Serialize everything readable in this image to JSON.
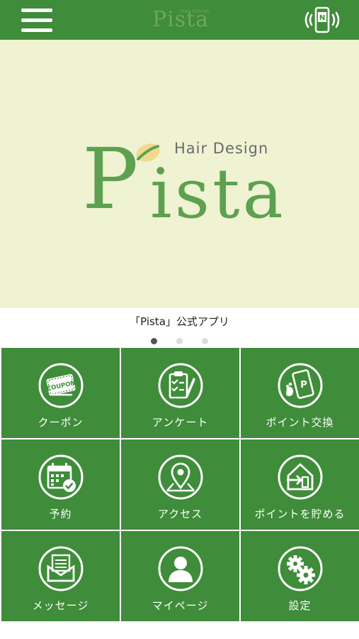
{
  "header": {
    "logo_text": "Pista",
    "logo_small": "Hair Design",
    "menu_icon": "hamburger-icon",
    "nfc_icon": "nfc-phone-icon",
    "color": "#3f8c3a"
  },
  "hero": {
    "logo_text": "Pista",
    "logo_subtitle": "Hair Design",
    "background": "#eff3d2",
    "logo_color": "#5da150"
  },
  "caption": "「Pista」公式アプリ",
  "carousel": {
    "count": 3,
    "active_index": 0
  },
  "menu": [
    {
      "label": "クーポン",
      "icon": "coupon-icon"
    },
    {
      "label": "アンケート",
      "icon": "survey-clipboard-icon"
    },
    {
      "label": "ポイント交換",
      "icon": "point-exchange-phone-icon"
    },
    {
      "label": "予約",
      "icon": "calendar-check-icon"
    },
    {
      "label": "アクセス",
      "icon": "map-pin-icon"
    },
    {
      "label": "ポイントを貯める",
      "icon": "collect-points-house-icon"
    },
    {
      "label": "メッセージ",
      "icon": "message-envelope-icon"
    },
    {
      "label": "マイページ",
      "icon": "user-profile-icon"
    },
    {
      "label": "設定",
      "icon": "gear-icon"
    }
  ]
}
